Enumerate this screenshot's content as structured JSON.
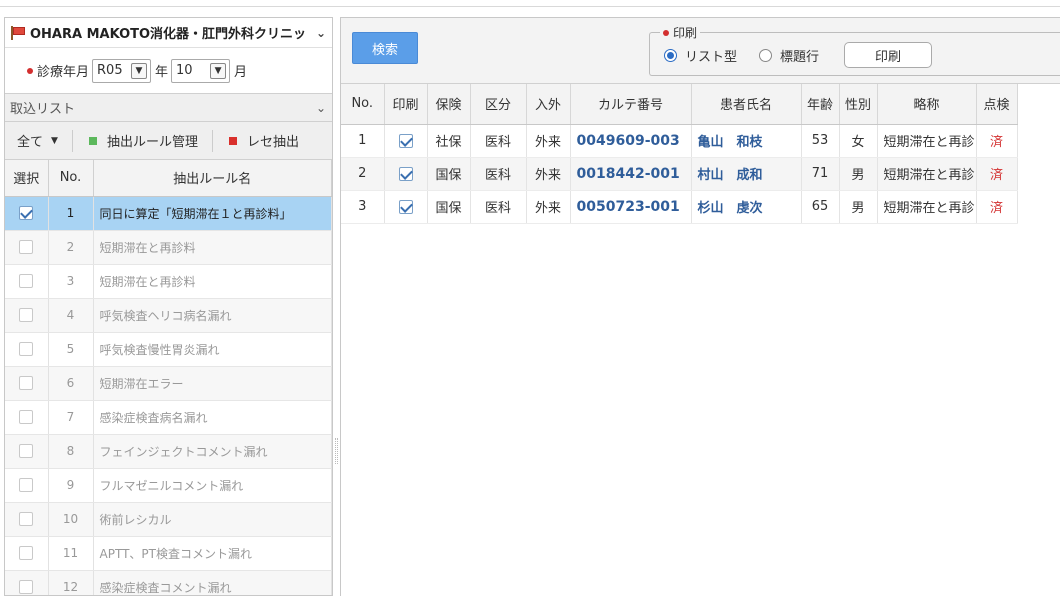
{
  "left": {
    "clinic_name": "OHARA MAKOTO消化器・肛門外科クリニッ",
    "period_label": "診療年月",
    "era_value": "R05",
    "year_unit": "年",
    "month_value": "10",
    "month_unit": "月",
    "import_list_label": "取込リスト",
    "filter_all": "全て",
    "rule_manage_label": "抽出ルール管理",
    "rece_extract_label": "レセ抽出",
    "columns": [
      "選択",
      "No.",
      "抽出ルール名"
    ],
    "rules": [
      {
        "checked": true,
        "no": "1",
        "name": "同日に算定「短期滞在１と再診料」",
        "selected": true
      },
      {
        "checked": false,
        "no": "2",
        "name": "短期滞在と再診料"
      },
      {
        "checked": false,
        "no": "3",
        "name": "短期滞在と再診料"
      },
      {
        "checked": false,
        "no": "4",
        "name": "呼気検査ヘリコ病名漏れ"
      },
      {
        "checked": false,
        "no": "5",
        "name": "呼気検査慢性胃炎漏れ"
      },
      {
        "checked": false,
        "no": "6",
        "name": "短期滞在エラー"
      },
      {
        "checked": false,
        "no": "7",
        "name": "感染症検査病名漏れ"
      },
      {
        "checked": false,
        "no": "8",
        "name": "フェインジェクトコメント漏れ"
      },
      {
        "checked": false,
        "no": "9",
        "name": "フルマゼニルコメント漏れ"
      },
      {
        "checked": false,
        "no": "10",
        "name": "術前レシカル"
      },
      {
        "checked": false,
        "no": "11",
        "name": "APTT、PT検査コメント漏れ"
      },
      {
        "checked": false,
        "no": "12",
        "name": "感染症検査コメント漏れ"
      }
    ]
  },
  "right": {
    "search_label": "検索",
    "print_group_label": "印刷",
    "radio_list": "リスト型",
    "radio_title_row": "標題行",
    "print_button": "印刷",
    "columns": [
      "No.",
      "印刷",
      "保険",
      "区分",
      "入外",
      "カルテ番号",
      "患者氏名",
      "年齢",
      "性別",
      "略称",
      "点検"
    ],
    "rows": [
      {
        "no": "1",
        "print": true,
        "insurance": "社保",
        "category": "医科",
        "inout": "外来",
        "chart_no": "0049609-003",
        "patient": "亀山　和枝",
        "age": "53",
        "sex": "女",
        "abbr": "短期滞在と再診",
        "check": "済"
      },
      {
        "no": "2",
        "print": true,
        "insurance": "国保",
        "category": "医科",
        "inout": "外来",
        "chart_no": "0018442-001",
        "patient": "村山　成和",
        "age": "71",
        "sex": "男",
        "abbr": "短期滞在と再診",
        "check": "済"
      },
      {
        "no": "3",
        "print": true,
        "insurance": "国保",
        "category": "医科",
        "inout": "外来",
        "chart_no": "0050723-001",
        "patient": "杉山　虔次",
        "age": "65",
        "sex": "男",
        "abbr": "短期滞在と再診",
        "check": "済"
      }
    ]
  },
  "colors": {
    "accent": "#5b9ee8",
    "selected_row": "#a8d3f3",
    "required_dot": "#d32f2f",
    "manage_icon": "#5cb85c",
    "extract_icon": "#d9302c"
  }
}
